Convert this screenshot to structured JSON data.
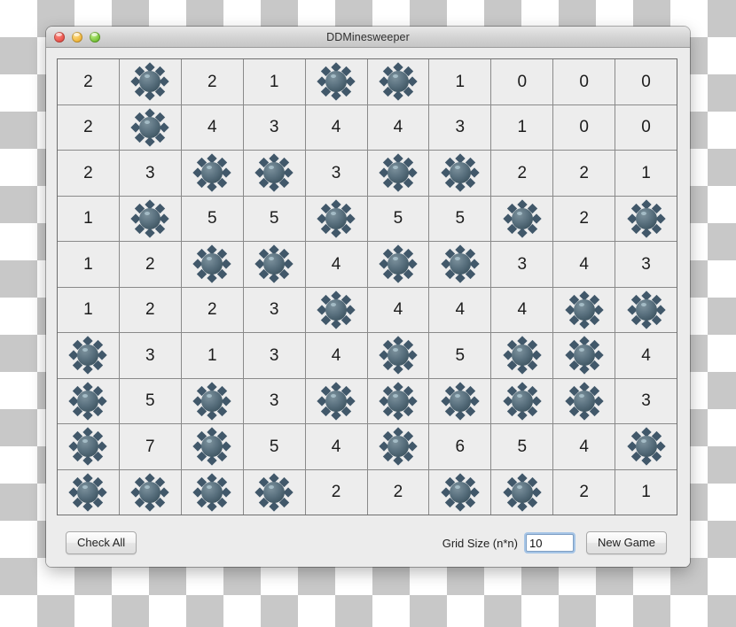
{
  "window": {
    "title": "DDMinesweeper",
    "traffic_lights": [
      {
        "name": "close",
        "color": "#e8524a"
      },
      {
        "name": "minimize",
        "color": "#f0b53a"
      },
      {
        "name": "maximize",
        "color": "#74c336"
      }
    ]
  },
  "board": {
    "rows": 10,
    "cols": 10,
    "mine_glyph": "mine-icon",
    "cell_bg": "#ededed",
    "grid_line": "#8a8a8a",
    "cells": [
      [
        "2",
        "mine",
        "2",
        "1",
        "mine",
        "mine",
        "1",
        "0",
        "0",
        "0"
      ],
      [
        "2",
        "mine",
        "4",
        "3",
        "4",
        "4",
        "3",
        "1",
        "0",
        "0"
      ],
      [
        "2",
        "3",
        "mine",
        "mine",
        "3",
        "mine",
        "mine",
        "2",
        "2",
        "1"
      ],
      [
        "1",
        "mine",
        "5",
        "5",
        "mine",
        "5",
        "5",
        "mine",
        "2",
        "mine"
      ],
      [
        "1",
        "2",
        "mine",
        "mine",
        "4",
        "mine",
        "mine",
        "3",
        "4",
        "3"
      ],
      [
        "1",
        "2",
        "2",
        "3",
        "mine",
        "4",
        "4",
        "4",
        "mine",
        "mine"
      ],
      [
        "mine",
        "3",
        "1",
        "3",
        "4",
        "mine",
        "5",
        "mine",
        "mine",
        "4"
      ],
      [
        "mine",
        "5",
        "mine",
        "3",
        "mine",
        "mine",
        "mine",
        "mine",
        "mine",
        "3"
      ],
      [
        "mine",
        "7",
        "mine",
        "5",
        "4",
        "mine",
        "6",
        "5",
        "4",
        "mine"
      ],
      [
        "mine",
        "mine",
        "mine",
        "mine",
        "2",
        "2",
        "mine",
        "mine",
        "2",
        "1"
      ]
    ]
  },
  "controls": {
    "check_all_label": "Check All",
    "grid_size_label": "Grid Size (n*n)",
    "grid_size_value": "10",
    "grid_size_placeholder": "",
    "new_game_label": "New Game"
  }
}
